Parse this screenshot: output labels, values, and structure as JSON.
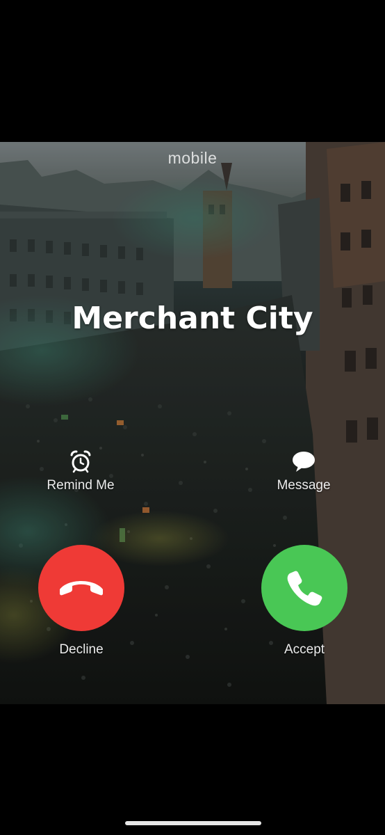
{
  "call": {
    "line_label": "mobile",
    "caller_name": "Merchant City"
  },
  "actions": {
    "remind_label": "Remind Me",
    "message_label": "Message",
    "decline_label": "Decline",
    "accept_label": "Accept"
  },
  "icons": {
    "remind": "alarm-clock-icon",
    "message": "speech-bubble-icon",
    "decline": "phone-hangup-icon",
    "accept": "phone-icon"
  },
  "colors": {
    "decline": "#ef3a36",
    "accept": "#49c755",
    "background": "#000000"
  }
}
